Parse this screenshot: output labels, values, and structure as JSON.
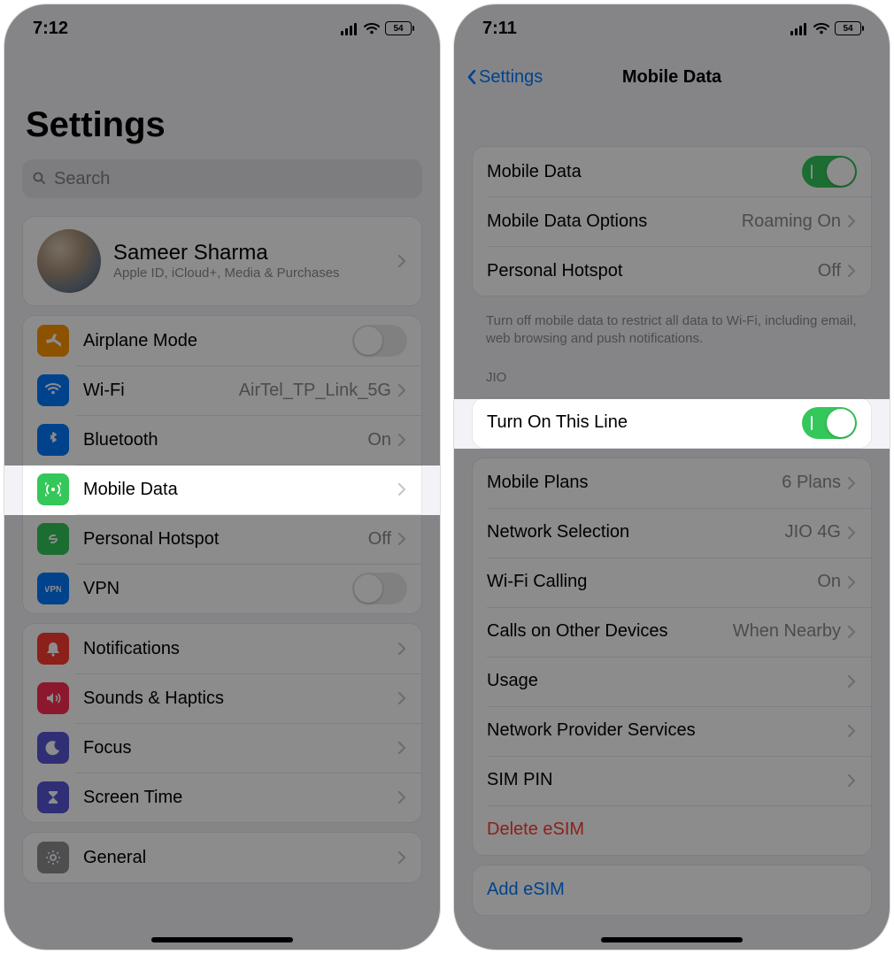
{
  "left": {
    "time": "7:12",
    "battery": "54",
    "title": "Settings",
    "search_placeholder": "Search",
    "profile": {
      "name": "Sameer Sharma",
      "sub": "Apple ID, iCloud+, Media & Purchases"
    },
    "group1": [
      {
        "label": "Airplane Mode",
        "icon": "airplane",
        "color": "#ff9500",
        "type": "toggle",
        "on": false
      },
      {
        "label": "Wi-Fi",
        "icon": "wifi",
        "color": "#007aff",
        "value": "AirTel_TP_Link_5G"
      },
      {
        "label": "Bluetooth",
        "icon": "bluetooth",
        "color": "#007aff",
        "value": "On"
      },
      {
        "label": "Mobile Data",
        "icon": "antenna",
        "color": "#34c759",
        "highlight": true
      },
      {
        "label": "Personal Hotspot",
        "icon": "link",
        "color": "#34c759",
        "value": "Off"
      },
      {
        "label": "VPN",
        "icon": "vpn",
        "color": "#007aff",
        "type": "toggle",
        "on": false
      }
    ],
    "group2": [
      {
        "label": "Notifications",
        "icon": "bell",
        "color": "#ff3b30"
      },
      {
        "label": "Sounds & Haptics",
        "icon": "speaker",
        "color": "#ff2d55"
      },
      {
        "label": "Focus",
        "icon": "moon",
        "color": "#5856d6"
      },
      {
        "label": "Screen Time",
        "icon": "hourglass",
        "color": "#5856d6"
      }
    ],
    "group3": [
      {
        "label": "General",
        "icon": "gear",
        "color": "#8e8e93"
      }
    ]
  },
  "right": {
    "time": "7:11",
    "battery": "54",
    "back_label": "Settings",
    "title": "Mobile Data",
    "group1": [
      {
        "label": "Mobile Data",
        "type": "toggle",
        "on": true
      },
      {
        "label": "Mobile Data Options",
        "value": "Roaming On"
      },
      {
        "label": "Personal Hotspot",
        "value": "Off"
      }
    ],
    "footer1": "Turn off mobile data to restrict all data to Wi-Fi, including email, web browsing and push notifications.",
    "header2": "JIO",
    "group2": [
      {
        "label": "Turn On This Line",
        "type": "toggle",
        "on": true,
        "highlight": true
      }
    ],
    "group3": [
      {
        "label": "Mobile Plans",
        "value": "6 Plans"
      },
      {
        "label": "Network Selection",
        "value": "JIO 4G"
      },
      {
        "label": "Wi-Fi Calling",
        "value": "On"
      },
      {
        "label": "Calls on Other Devices",
        "value": "When Nearby"
      },
      {
        "label": "Usage"
      },
      {
        "label": "Network Provider Services"
      },
      {
        "label": "SIM PIN"
      },
      {
        "label": "Delete eSIM",
        "style": "destructive"
      }
    ],
    "group4": [
      {
        "label": "Add eSIM",
        "style": "link"
      }
    ]
  }
}
